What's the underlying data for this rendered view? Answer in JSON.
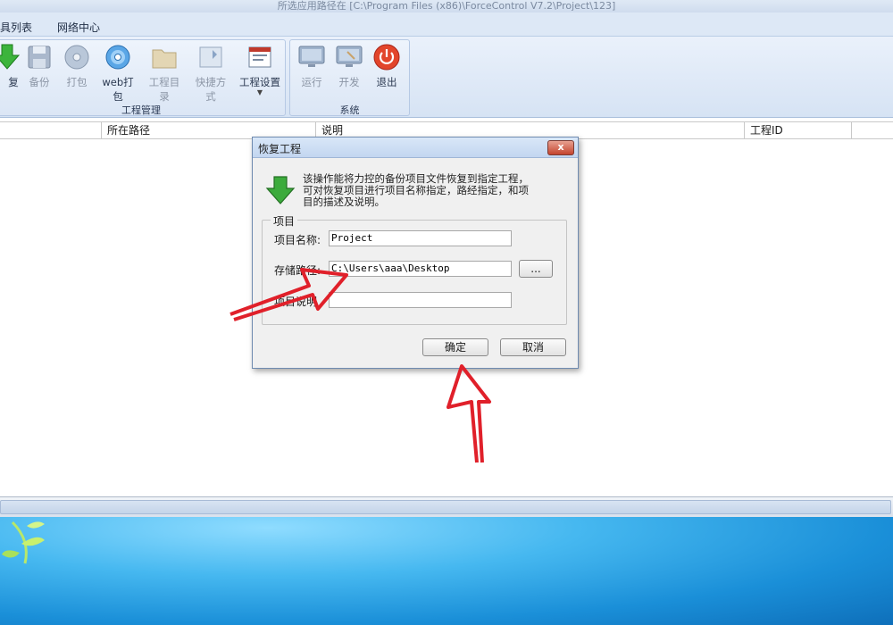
{
  "window": {
    "title": "所选应用路径在 [C:\\Program Files (x86)\\ForceControl V7.2\\Project\\123]"
  },
  "menu": {
    "items": [
      "具列表",
      "网络中心"
    ]
  },
  "ribbon": {
    "groups": [
      {
        "label": "工程管理",
        "buttons": [
          "复",
          "备份",
          "打包",
          "web打包",
          "工程目录",
          "快捷方式",
          "工程设置"
        ]
      },
      {
        "label": "系统",
        "buttons": [
          "运行",
          "开发",
          "退出"
        ]
      }
    ]
  },
  "list": {
    "columns": [
      "所在路径",
      "说明",
      "工程ID"
    ]
  },
  "dialog": {
    "title": "恢复工程",
    "close_label": "x",
    "description": "该操作能将力控的备份项目文件恢复到指定工程，可对恢复项目进行项目名称指定，路经指定，和项目的描述及说明。",
    "group_label": "项目",
    "fields": {
      "name": {
        "label": "项目名称:",
        "value": "Project"
      },
      "path": {
        "label": "存储路径:",
        "value": "C:\\Users\\aaa\\Desktop",
        "browse_label": "..."
      },
      "desc": {
        "label": "项目说明",
        "value": ""
      }
    },
    "ok_label": "确定",
    "cancel_label": "取消"
  },
  "colors": {
    "arrow": "#e0202a",
    "accent": "#3b7fd0"
  }
}
